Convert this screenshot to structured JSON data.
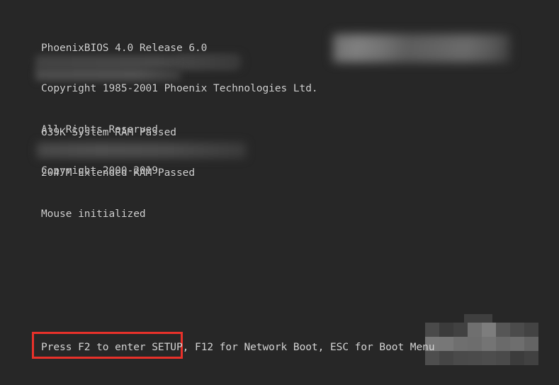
{
  "screen": {
    "background_color": "#272727",
    "text_color": "#d4d4d4",
    "highlight_color": "#e8312a"
  },
  "bios": {
    "header_lines": [
      "PhoenixBIOS 4.0 Release 6.0",
      "Copyright 1985-2001 Phoenix Technologies Ltd.",
      "All Rights Reserved",
      "Copyright 2000-2019"
    ],
    "memory_lines": [
      "639K System RAM Passed",
      "2047M Extended RAM Passed",
      "Mouse initialized"
    ]
  },
  "prompt": {
    "highlighted_text": "Press F2 to enter SETUP,",
    "rest_text": " F12 for Network Boot, ESC for Boot Menu",
    "full_text": "Press F2 to enter SETUP, F12 for Network Boot, ESC for Boot Menu"
  },
  "redactions": {
    "top_right": "blurred-redaction-block",
    "copyright_trailing": "blurred-redaction-block",
    "mouse_trailing": "blurred-redaction-block",
    "bottom_right": "mosaic-redaction-block",
    "mosaic_tiles": [
      "#4a4a4a",
      "#3b3b3b",
      "#414141",
      "#6f6f6f",
      "#7d7d7d",
      "#565656",
      "#4b4b4b",
      "#434343",
      "#787878",
      "#777777",
      "#6f6f6f",
      "#6d6d6d",
      "#747474",
      "#6a6a6a",
      "#6e6e6e",
      "#646464",
      "#4e4e4e",
      "#454545",
      "#4a4a4a",
      "#4b4b4b",
      "#4d4d4d",
      "#4a4a4a",
      "#3c3c3c",
      "#414141"
    ]
  }
}
